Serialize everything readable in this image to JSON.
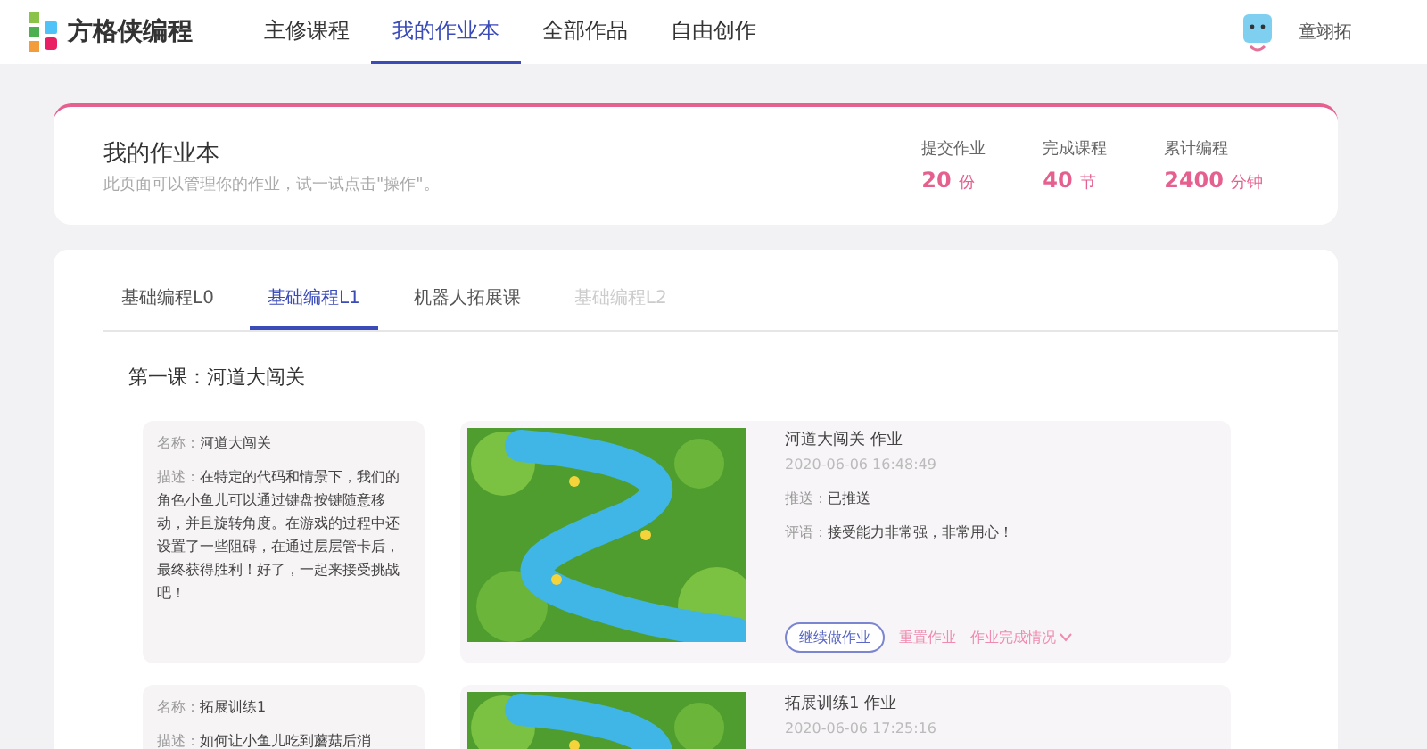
{
  "header": {
    "logo_text": "方格侠编程",
    "nav": [
      {
        "label": "主修课程",
        "selected": false
      },
      {
        "label": "我的作业本",
        "selected": true
      },
      {
        "label": "全部作品",
        "selected": false
      },
      {
        "label": "自由创作",
        "selected": false
      }
    ],
    "user_name": "童翊拓"
  },
  "summary": {
    "title": "我的作业本",
    "subtitle": "此页面可以管理你的作业，试一试点击\"操作\"。",
    "stats": [
      {
        "label": "提交作业",
        "value": "20",
        "unit": "份"
      },
      {
        "label": "完成课程",
        "value": "40",
        "unit": "节"
      },
      {
        "label": "累计编程",
        "value": "2400",
        "unit": "分钟"
      }
    ]
  },
  "tabs": [
    {
      "label": "基础编程L0",
      "selected": false,
      "disabled": false
    },
    {
      "label": "基础编程L1",
      "selected": true,
      "disabled": false
    },
    {
      "label": "机器人拓展课",
      "selected": false,
      "disabled": false
    },
    {
      "label": "基础编程L2",
      "selected": false,
      "disabled": true
    }
  ],
  "lesson_title": "第一课：河道大闯关",
  "homeworks": [
    {
      "info": [
        {
          "label": "名称：",
          "value": "河道大闯关"
        },
        {
          "label": "描述：",
          "value": "在特定的代码和情景下，我们的角色小鱼儿可以通过键盘按键随意移动，并且旋转角度。在游戏的过程中还设置了一些阻碍，在通过层层管卡后，最终获得胜利！好了，一起来接受挑战吧！"
        }
      ],
      "work_title": "河道大闯关 作业",
      "date": "2020-06-06 16:48:49",
      "fields": [
        {
          "label": "推送：",
          "value": "已推送"
        },
        {
          "label": "评语：",
          "value": "接受能力非常强，非常用心！"
        }
      ],
      "actions": [
        {
          "kind": "outline",
          "label": "继续做作业"
        },
        {
          "kind": "link",
          "label": "重置作业"
        },
        {
          "kind": "dropdown",
          "label": "作业完成情况"
        }
      ]
    },
    {
      "info": [
        {
          "label": "名称：",
          "value": "拓展训练1"
        },
        {
          "label": "描述：",
          "value": "如何让小鱼儿吃到蘑菇后消"
        }
      ],
      "work_title": "拓展训练1 作业",
      "date": "2020-06-06 17:25:16"
    }
  ]
}
